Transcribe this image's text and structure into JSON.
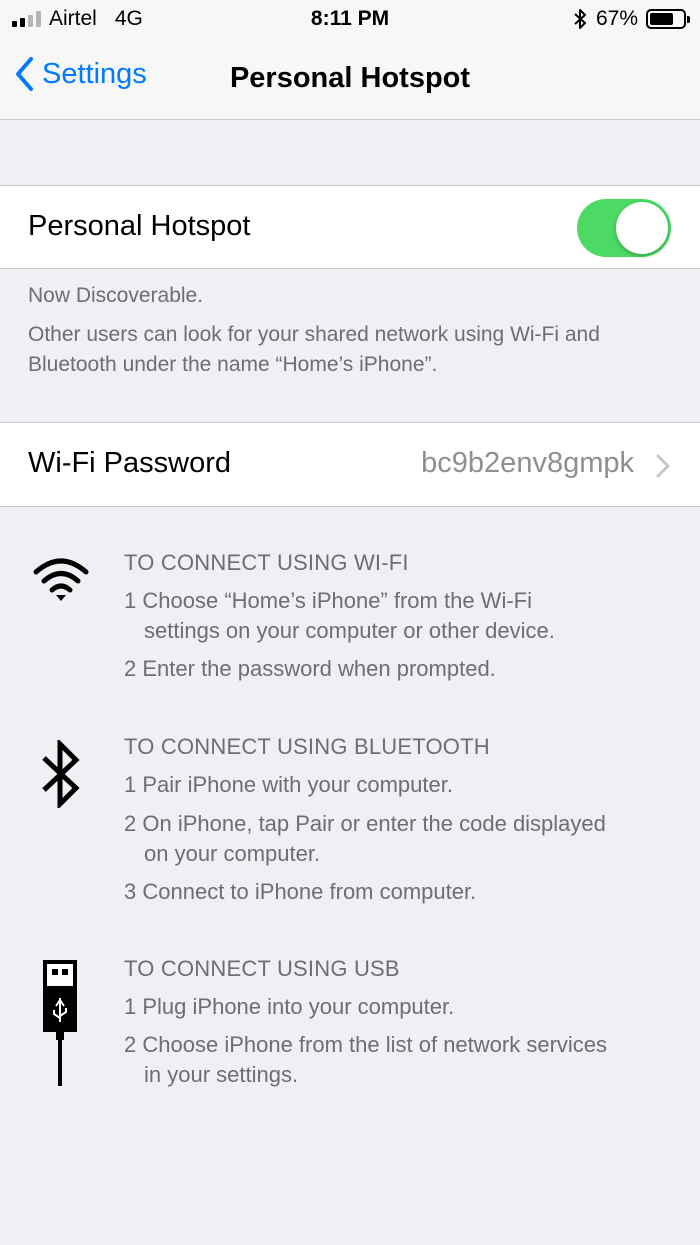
{
  "status_bar": {
    "carrier": "Airtel",
    "network": "4G",
    "time": "8:11 PM",
    "battery": "67%",
    "battery_level": 0.67,
    "signal_bars_filled": 2,
    "signal_bars_total": 4,
    "icons": [
      "signal-icon",
      "bluetooth-icon",
      "battery-icon"
    ]
  },
  "nav": {
    "back_label": "Settings",
    "title": "Personal Hotspot"
  },
  "hotspot": {
    "label": "Personal Hotspot",
    "enabled": true,
    "toggle_color": "#4cd964"
  },
  "discoverable": {
    "status": "Now Discoverable.",
    "description": "Other users can look for your shared network using Wi-Fi and Bluetooth under the name “Home’s iPhone”."
  },
  "wifi_password": {
    "label": "Wi-Fi Password",
    "value": "bc9b2env8gmpk"
  },
  "instructions": {
    "wifi": {
      "icon": "wifi-icon",
      "heading": "TO CONNECT USING WI-FI",
      "steps": [
        {
          "num": "1",
          "text_a": "Choose “Home’s iPhone” from the Wi-Fi",
          "text_b": "settings on your computer or other device."
        },
        {
          "num": "2",
          "text_a": "Enter the password when prompted."
        }
      ]
    },
    "bluetooth": {
      "icon": "bluetooth-icon",
      "heading": "TO CONNECT USING BLUETOOTH",
      "steps": [
        {
          "num": "1",
          "text_a": "Pair iPhone with your computer."
        },
        {
          "num": "2",
          "text_a": "On iPhone, tap Pair or enter the code displayed",
          "text_b": "on your computer."
        },
        {
          "num": "3",
          "text_a": "Connect to iPhone from computer."
        }
      ]
    },
    "usb": {
      "icon": "usb-icon",
      "heading": "TO CONNECT USING USB",
      "steps": [
        {
          "num": "1",
          "text_a": "Plug iPhone into your computer."
        },
        {
          "num": "2",
          "text_a": "Choose iPhone from the list of network services",
          "text_b": "in your settings."
        }
      ]
    }
  },
  "colors": {
    "accent": "#007aff",
    "background": "#efeff4",
    "secondary_text": "#6d6d72",
    "toggle_on": "#4cd964"
  }
}
